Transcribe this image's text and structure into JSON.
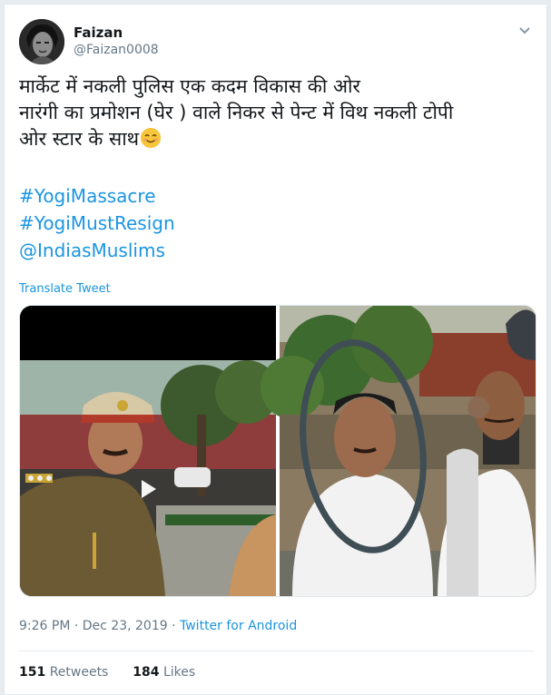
{
  "author": {
    "name": "Faizan",
    "handle": "@Faizan0008"
  },
  "tweet": {
    "lines": [
      "मार्केट में नकली पुलिस एक कदम विकास की ओर",
      "नारंगी का प्रमोशन (घेर ) वाले निकर से पेन्ट में विथ नकली टोपी",
      "ओर स्टार के साथ"
    ],
    "emoji": "smiling-face-emoji",
    "tags": [
      "#YogiMassacre",
      "#YogiMustResign",
      "@IndiasMuslims"
    ]
  },
  "translate_label": "Translate Tweet",
  "meta": {
    "time": "9:26 PM · Dec 23, 2019 · ",
    "source": "Twitter for Android"
  },
  "stats": {
    "retweets_count": "151",
    "retweets_label": "Retweets",
    "likes_count": "184",
    "likes_label": "Likes"
  },
  "colors": {
    "link": "#1b95e0",
    "secondary": "#657786",
    "text": "#14171a"
  },
  "icons": {
    "menu": "chevron-down-icon",
    "play": "play-icon"
  }
}
